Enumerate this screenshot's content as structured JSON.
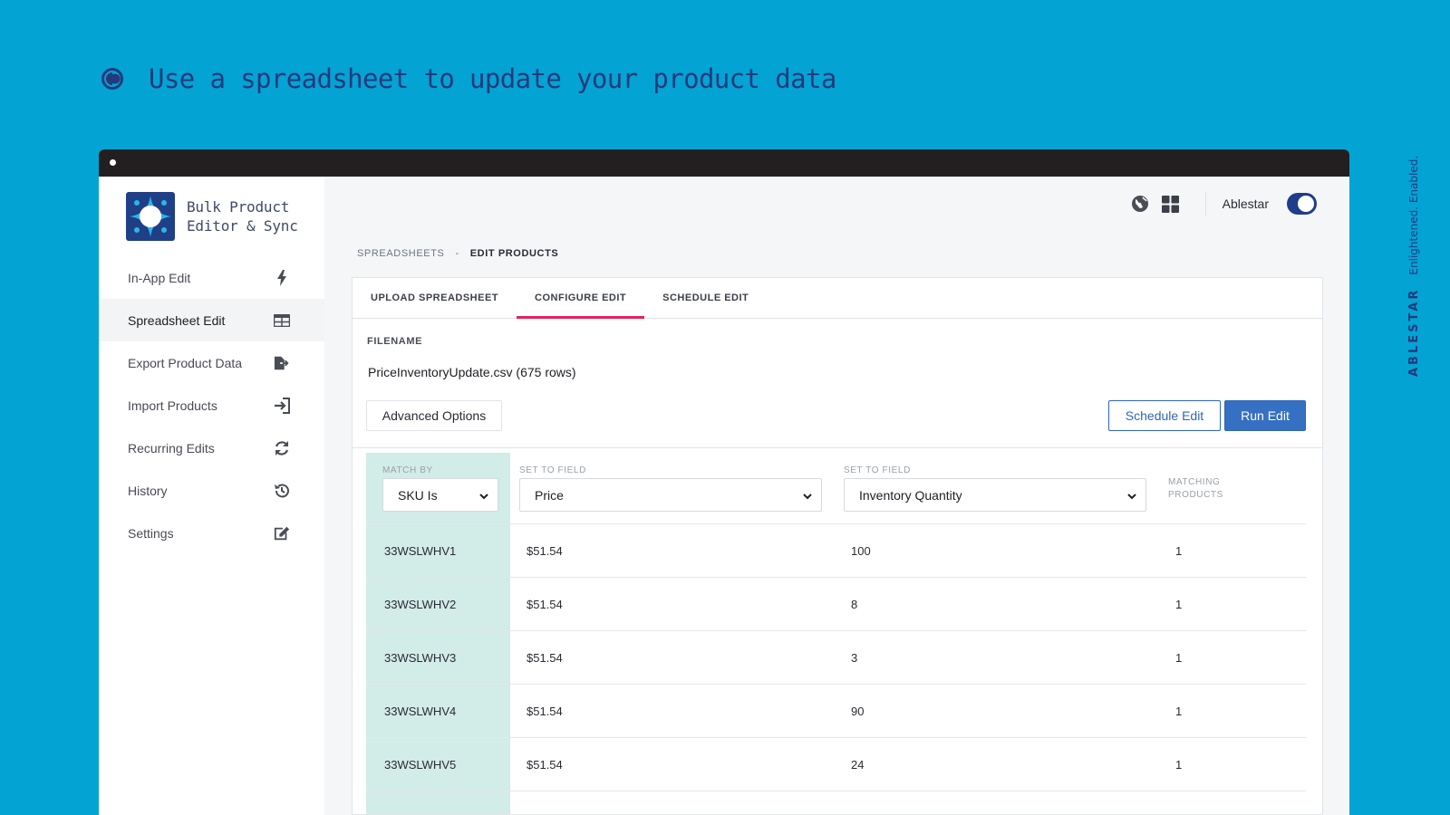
{
  "headline": "Use a spreadsheet to update your product data",
  "brand": {
    "name": "ABLESTAR",
    "tagline": "Enlightened. Enabled."
  },
  "app": {
    "name_line1": "Bulk Product",
    "name_line2": "Editor & Sync"
  },
  "sidebar": {
    "items": [
      {
        "label": "In-App Edit",
        "icon": "bolt-icon"
      },
      {
        "label": "Spreadsheet Edit",
        "icon": "table-icon",
        "active": true
      },
      {
        "label": "Export Product Data",
        "icon": "file-export-icon"
      },
      {
        "label": "Import Products",
        "icon": "sign-in-icon"
      },
      {
        "label": "Recurring Edits",
        "icon": "refresh-icon"
      },
      {
        "label": "History",
        "icon": "history-icon"
      },
      {
        "label": "Settings",
        "icon": "edit-icon"
      }
    ]
  },
  "topbar": {
    "store_name": "Ablestar",
    "toggle_on": true
  },
  "breadcrumb": {
    "parent": "SPREADSHEETS",
    "separator": "-",
    "current": "EDIT PRODUCTS"
  },
  "tabs": [
    {
      "label": "UPLOAD SPREADSHEET"
    },
    {
      "label": "CONFIGURE EDIT",
      "active": true
    },
    {
      "label": "SCHEDULE EDIT"
    }
  ],
  "file": {
    "label": "FILENAME",
    "value": "PriceInventoryUpdate.csv (675 rows)"
  },
  "buttons": {
    "advanced": "Advanced Options",
    "schedule": "Schedule Edit",
    "run": "Run Edit"
  },
  "grid": {
    "match_header": "MATCH BY",
    "match_value": "SKU Is",
    "set1_header": "SET TO FIELD",
    "set1_value": "Price",
    "set2_header": "SET TO FIELD",
    "set2_value": "Inventory Quantity",
    "matching_header_line1": "MATCHING",
    "matching_header_line2": "PRODUCTS",
    "rows": [
      {
        "sku": "33WSLWHV1",
        "price": "$51.54",
        "qty": "100",
        "matching": "1"
      },
      {
        "sku": "33WSLWHV2",
        "price": "$51.54",
        "qty": "8",
        "matching": "1"
      },
      {
        "sku": "33WSLWHV3",
        "price": "$51.54",
        "qty": "3",
        "matching": "1"
      },
      {
        "sku": "33WSLWHV4",
        "price": "$51.54",
        "qty": "90",
        "matching": "1"
      },
      {
        "sku": "33WSLWHV5",
        "price": "$51.54",
        "qty": "24",
        "matching": "1"
      }
    ]
  },
  "colors": {
    "background": "#03a3d4",
    "accent": "#e0245e",
    "primary": "#3670c2",
    "navy": "#243a7c",
    "match_column": "#d2ece8"
  }
}
